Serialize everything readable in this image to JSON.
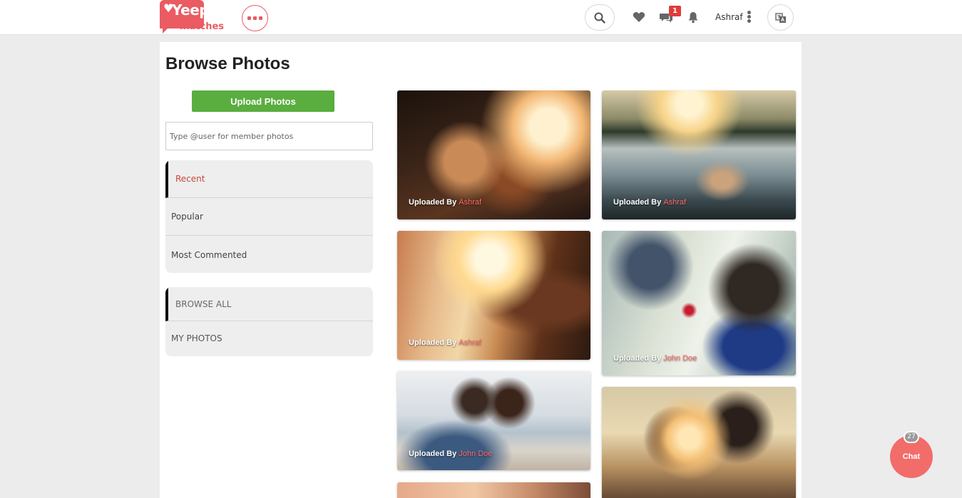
{
  "header": {
    "logo_line1": "Yeep",
    "logo_line2": "matches",
    "notification_count": "1",
    "user_name": "Ashraf"
  },
  "page": {
    "title": "Browse Photos",
    "upload_label": "Upload Photos",
    "member_search_placeholder": "Type @user for member photos"
  },
  "sort_menu": {
    "items": [
      {
        "label": "Recent",
        "active": true
      },
      {
        "label": "Popular",
        "active": false
      },
      {
        "label": "Most Commented",
        "active": false
      }
    ]
  },
  "browse_menu": {
    "items": [
      {
        "label": "BROWSE ALL",
        "active": true
      },
      {
        "label": "MY PHOTOS",
        "active": false
      }
    ]
  },
  "photos": [
    {
      "caption_prefix": "Uploaded By",
      "uploader": "Ashraf"
    },
    {
      "caption_prefix": "Uploaded By",
      "uploader": "Ashraf"
    },
    {
      "caption_prefix": "Uploaded By",
      "uploader": "Ashraf"
    },
    {
      "caption_prefix": "Uploaded By",
      "uploader": "John Doe"
    },
    {
      "caption_prefix": "Uploaded By",
      "uploader": "John Doe"
    },
    {
      "caption_prefix": "",
      "uploader": ""
    },
    {
      "caption_prefix": "",
      "uploader": ""
    }
  ],
  "chat": {
    "label": "Chat",
    "count": "27"
  },
  "colors": {
    "brand": "#ea5b62",
    "upload_button": "#5aad3f",
    "uploader_link": "#ff6b6b",
    "active_menu_text": "#c6493e",
    "chat_button": "#f26c6a"
  },
  "icons": {
    "more": "more-options-icon",
    "search": "search-icon",
    "favorites": "heart-icon",
    "messages": "chat-bubbles-icon",
    "notifications": "bell-icon",
    "user_menu": "kebab-menu-icon",
    "language": "language-icon"
  }
}
